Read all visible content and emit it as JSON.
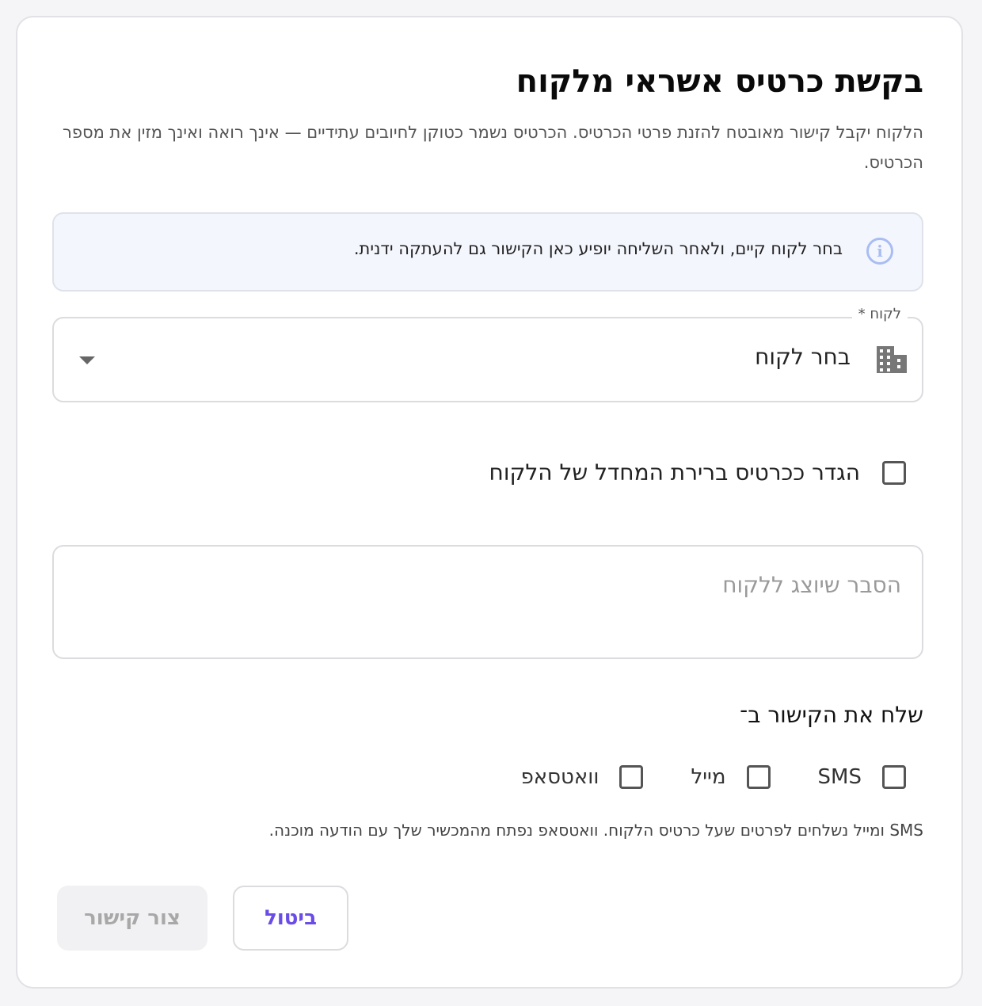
{
  "dialog": {
    "title": "בקשת כרטיס אשראי מלקוח",
    "subtitle": "הלקוח יקבל קישור מאובטח להזנת פרטי הכרטיס. הכרטיס נשמר כטוקן לחיובים עתידיים — אינך רואה ואינך מזין את מספר הכרטיס."
  },
  "info": {
    "icon": "info-icon",
    "text": "בחר לקוח קיים, ולאחר השליחה יופיע כאן הקישור גם להעתקה ידנית."
  },
  "customer_select": {
    "label": "לקוח *",
    "value": "בחר לקוח",
    "icon": "building-icon"
  },
  "saved_card": {
    "label": "הגדר ככרטיס ברירת המחדל של הלקוח",
    "checked": false
  },
  "explanation": {
    "placeholder": "הסבר שיוצג ללקוח",
    "value": ""
  },
  "send": {
    "title": "שלח את הקישור ב־",
    "channels": [
      {
        "label": "SMS",
        "checked": false
      },
      {
        "label": "מייל",
        "checked": false
      },
      {
        "label": "וואטסאפ",
        "checked": false
      }
    ],
    "note": "SMS ומייל נשלחים לפרטים שעל כרטיס הלקוח. וואטסאפ נפתח מהמכשיר שלך עם הודעה מוכנה."
  },
  "actions": {
    "cancel_label": "ביטול",
    "create_label": "צור קישור"
  },
  "colors": {
    "accent": "#6b4ce6",
    "info_bg": "#f4f6fe",
    "info_icon": "#a9bdf2",
    "disabled_bg": "#f1f1f3"
  }
}
